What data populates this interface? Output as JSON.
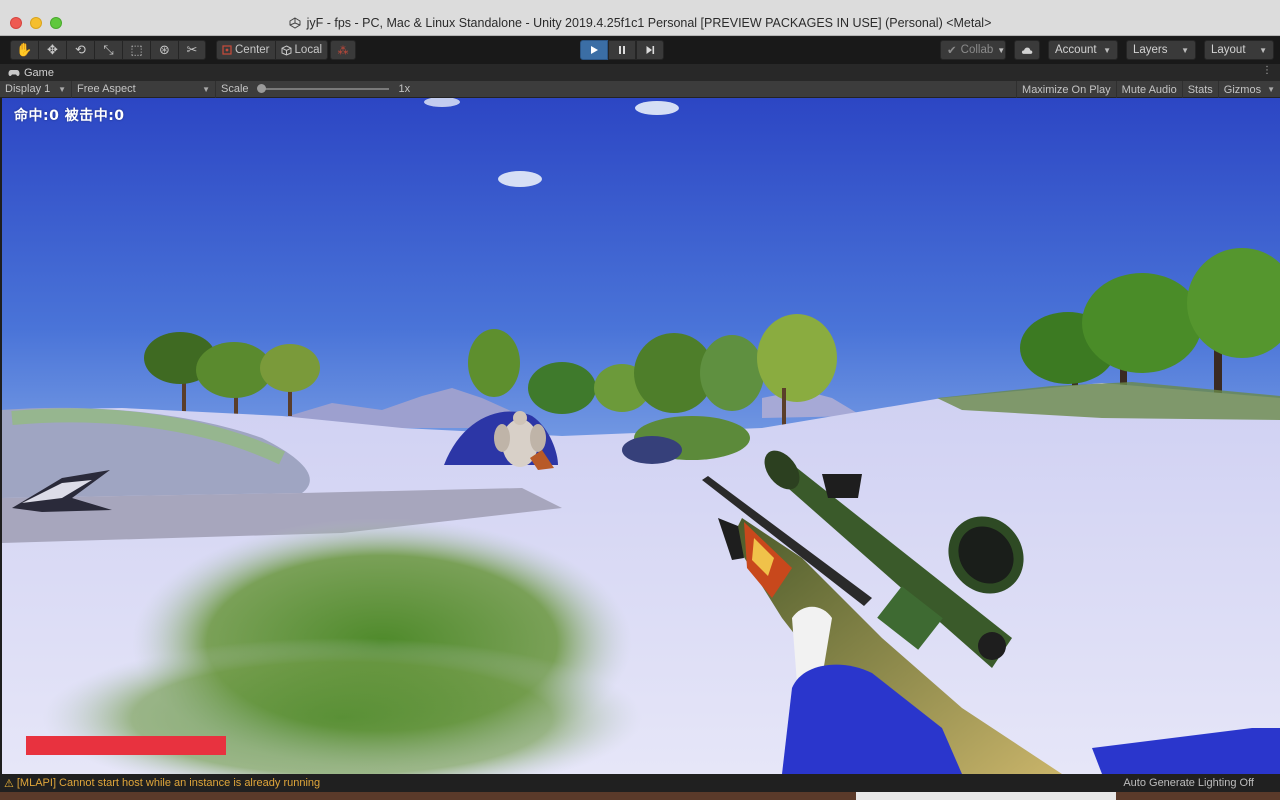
{
  "window": {
    "title": "jyF - fps - PC, Mac & Linux Standalone - Unity 2019.4.25f1c1 Personal [PREVIEW PACKAGES IN USE] (Personal) <Metal>"
  },
  "toolbar": {
    "tools": [
      {
        "name": "hand-tool",
        "icon": "hand-icon",
        "glyph": "✋"
      },
      {
        "name": "move-tool",
        "icon": "move-icon",
        "glyph": "✥"
      },
      {
        "name": "rotate-tool",
        "icon": "rotate-icon",
        "glyph": "⟲"
      },
      {
        "name": "scale-tool",
        "icon": "scale-icon",
        "glyph": "⤡"
      },
      {
        "name": "rect-tool",
        "icon": "rect-icon",
        "glyph": "⬚"
      },
      {
        "name": "transform-tool",
        "icon": "transform-icon",
        "glyph": "⊛"
      },
      {
        "name": "custom-tool",
        "icon": "custom-tools-icon",
        "glyph": "✂"
      }
    ],
    "pivot_label": "Center",
    "pivot_rotation_label": "Local",
    "collab_label": "Collab",
    "account_label": "Account",
    "layers_label": "Layers",
    "layout_label": "Layout"
  },
  "game_tab": {
    "label": "Game",
    "display": "Display 1",
    "aspect": "Free Aspect",
    "scale_label": "Scale",
    "scale_value": "1x",
    "scale_fraction": 0.0,
    "maximize_on_play": "Maximize On Play",
    "mute_audio": "Mute Audio",
    "stats": "Stats",
    "gizmos": "Gizmos"
  },
  "hud": {
    "score_text": "命中:0  被击中:0",
    "health_fraction": 1.0,
    "health_color": "#e8323f"
  },
  "status": {
    "message": "[MLAPI] Cannot start host while an instance is already running",
    "right_text": "Auto Generate Lighting Off"
  },
  "colors": {
    "play_active": "#3b6ea5",
    "warning": "#e0a63a"
  }
}
